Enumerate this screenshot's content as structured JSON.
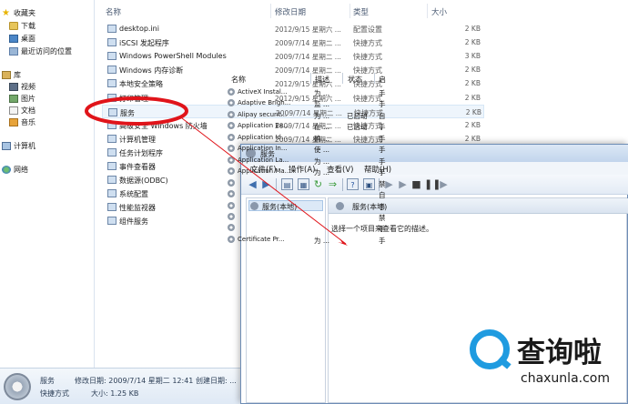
{
  "nav": {
    "favorites": "收藏夹",
    "downloads": "下载",
    "desktop": "桌面",
    "recent": "最近访问的位置",
    "libraries": "库",
    "videos": "视频",
    "pictures": "图片",
    "documents": "文档",
    "music": "音乐",
    "computer": "计算机",
    "network": "网络"
  },
  "columns": {
    "name": "名称",
    "modified": "修改日期",
    "type": "类型",
    "size": "大小"
  },
  "files": [
    {
      "name": "desktop.ini",
      "date": "2012/9/15 星期六 ...",
      "type": "配置设置",
      "size": "2 KB"
    },
    {
      "name": "iSCSI 发起程序",
      "date": "2009/7/14 星期二 ...",
      "type": "快捷方式",
      "size": "2 KB"
    },
    {
      "name": "Windows PowerShell Modules",
      "date": "2009/7/14 星期二 ...",
      "type": "快捷方式",
      "size": "3 KB"
    },
    {
      "name": "Windows 内存诊断",
      "date": "2009/7/14 星期二 ...",
      "type": "快捷方式",
      "size": "2 KB"
    },
    {
      "name": "本地安全策略",
      "date": "2012/9/15 星期六 ...",
      "type": "快捷方式",
      "size": "2 KB"
    },
    {
      "name": "打印管理",
      "date": "2012/9/15 星期六 ...",
      "type": "快捷方式",
      "size": "2 KB"
    },
    {
      "name": "服务",
      "date": "2009/7/14 星期二 ...",
      "type": "快捷方式",
      "size": "2 KB"
    },
    {
      "name": "高级安全 Windows 防火墙",
      "date": "2009/7/14 星期二 ...",
      "type": "快捷方式",
      "size": "2 KB"
    },
    {
      "name": "计算机管理",
      "date": "2009/7/14 星期二 ...",
      "type": "快捷方式",
      "size": "2 KB"
    },
    {
      "name": "任务计划程序",
      "date": "",
      "type": "",
      "size": ""
    },
    {
      "name": "事件查看器",
      "date": "",
      "type": "",
      "size": ""
    },
    {
      "name": "数据源(ODBC)",
      "date": "",
      "type": "",
      "size": ""
    },
    {
      "name": "系统配置",
      "date": "",
      "type": "",
      "size": ""
    },
    {
      "name": "性能监视器",
      "date": "",
      "type": "",
      "size": ""
    },
    {
      "name": "组件服务",
      "date": "",
      "type": "",
      "size": ""
    }
  ],
  "details": {
    "name": "服务",
    "kind": "快捷方式",
    "modified": "修改日期: 2009/7/14 星期二 12:41 创建日期: ...",
    "size": "大小: 1.25 KB"
  },
  "services_window": {
    "title": "服务",
    "menu": [
      "文件(F)",
      "操作(A)",
      "查看(V)",
      "帮助(H)"
    ],
    "tree_item": "服务(本地)",
    "header": "服务(本地)",
    "description": "选择一个项目来查看它的描述。",
    "columns": {
      "name": "名称",
      "desc": "描述",
      "state": "状态",
      "startup": "启"
    },
    "rows": [
      {
        "name": "ActiveX Instal...",
        "desc": "为 ...",
        "state": "",
        "startup": "手"
      },
      {
        "name": "Adaptive Brigh...",
        "desc": "监 ...",
        "state": "",
        "startup": "手"
      },
      {
        "name": "Alipay securit...",
        "desc": "为 ...",
        "state": "已启动",
        "startup": "自"
      },
      {
        "name": "Application Ex...",
        "desc": "在 ...",
        "state": "已启动",
        "startup": "手"
      },
      {
        "name": "Application Id...",
        "desc": "确 ...",
        "state": "",
        "startup": "手"
      },
      {
        "name": "Application In...",
        "desc": "使 ...",
        "state": "",
        "startup": "手"
      },
      {
        "name": "Application La...",
        "desc": "为 ...",
        "state": "",
        "startup": "手"
      },
      {
        "name": "Application Ma...",
        "desc": "为 ...",
        "state": "",
        "startup": "手"
      },
      {
        "name": "",
        "desc": "",
        "state": "",
        "startup": "禁"
      },
      {
        "name": "",
        "desc": "",
        "state": "",
        "startup": "自"
      },
      {
        "name": "",
        "desc": "",
        "state": "",
        "startup": "手"
      },
      {
        "name": "",
        "desc": "",
        "state": "",
        "startup": "禁"
      },
      {
        "name": "",
        "desc": "",
        "state": "",
        "startup": "手"
      },
      {
        "name": "Certificate Pr...",
        "desc": "为 ...",
        "state": "",
        "startup": "手"
      }
    ]
  },
  "watermark": {
    "text": "查询啦",
    "url": "chaxunla.com"
  },
  "colors": {
    "annotation": "#e0141a",
    "watermark_blue": "#1f9be0"
  }
}
